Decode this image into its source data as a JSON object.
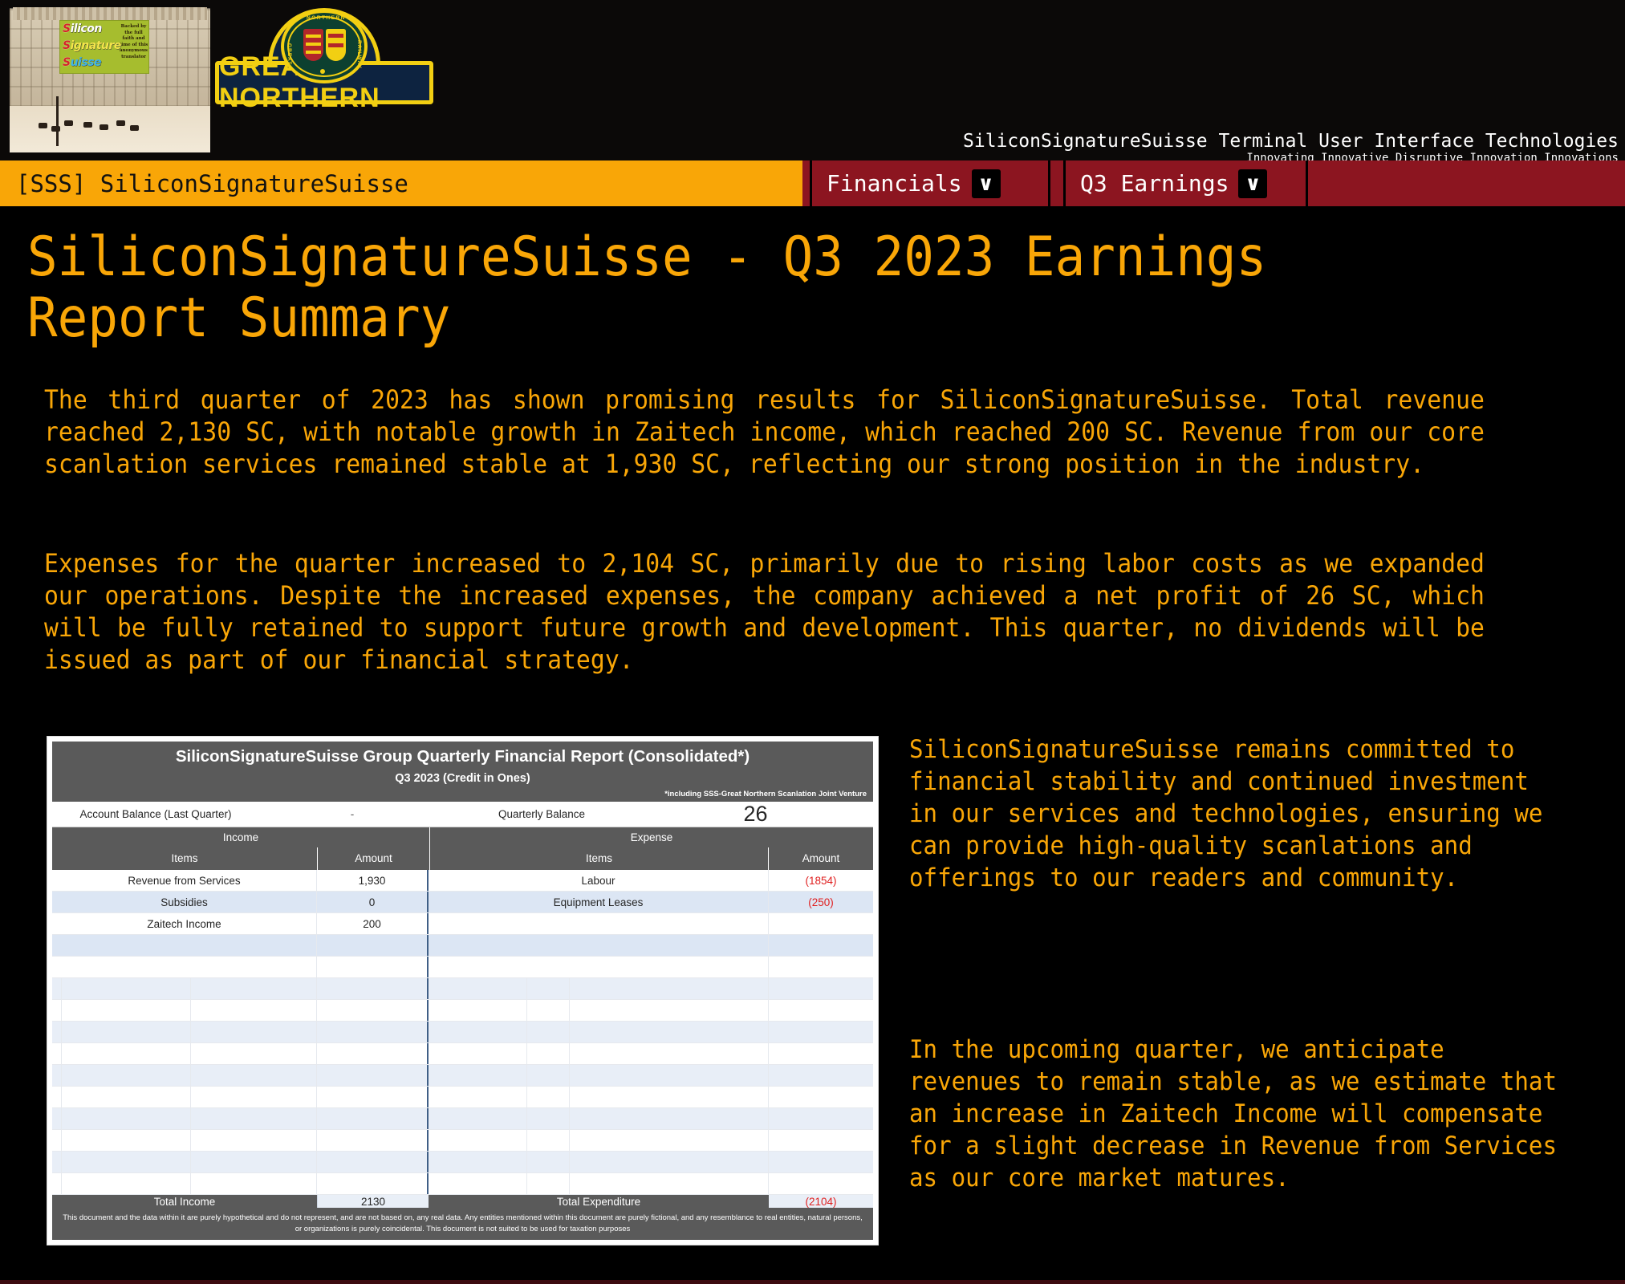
{
  "banner": {
    "billboard": {
      "s": "S",
      "word1": "ilicon",
      "word2": "ignature",
      "word3": "uisse",
      "side_text": "Backed by the full faith and time of this anonymous translator"
    },
    "great_northern": {
      "wordmark": "GREAT   NORTHERN",
      "ring_top": "NORTHERN",
      "ring_left": "GREAT",
      "ring_right": "RAILWAY"
    },
    "brand_line1": "SiliconSignatureSuisse Terminal User Interface Technologies",
    "brand_line2": "Innovating Innovative Disruptive Innovation Innovations"
  },
  "nav": {
    "brand": "[SSS] SiliconSignatureSuisse",
    "tabs": [
      {
        "label": "Financials",
        "caret": "∨"
      },
      {
        "label": "Q3 Earnings",
        "caret": "∨"
      }
    ]
  },
  "main": {
    "title": "SiliconSignatureSuisse - Q3 2023 Earnings Report Summary",
    "paragraph1": "The third quarter of 2023 has shown promising results for SiliconSignatureSuisse. Total revenue reached 2,130 SC, with notable growth in Zaitech income, which reached 200 SC. Revenue from our core scanlation services remained stable at 1,930 SC, reflecting our strong position in the industry.",
    "paragraph2": "Expenses for the quarter increased to 2,104 SC, primarily due to rising labor costs as we expanded our operations. Despite the increased expenses, the company achieved a net profit of 26 SC, which will be fully retained to support future growth and development. This quarter, no dividends will be issued as part of our financial strategy."
  },
  "sidebar": {
    "paragraph1": "SiliconSignatureSuisse remains committed to financial stability and continued investment in our services and technologies, ensuring we can provide high-quality scanlations and offerings to our readers and community.",
    "paragraph2": "In the upcoming quarter, we anticipate revenues to remain stable, as we estimate that an increase in Zaitech Income will compensate for a slight decrease in Revenue from Services as our core market matures."
  },
  "report": {
    "title": "SiliconSignatureSuisse Group Quarterly Financial Report (Consolidated*)",
    "subtitle": "Q3 2023 (Credit in Ones)",
    "note": "*including SSS-Great Northern Scanlation Joint Venture",
    "balance_label": "Account Balance (Last Quarter)",
    "balance_value": "-",
    "quarterly_label": "Quarterly Balance",
    "quarterly_value": "26",
    "group_income": "Income",
    "group_expense": "Expense",
    "col_items_income": "Items",
    "col_amount_income": "Amount",
    "col_items_expense": "Items",
    "col_amount_expense": "Amount",
    "rows": [
      {
        "income_item": "Revenue from Services",
        "income_amount": "1,930",
        "expense_item": "Labour",
        "expense_amount": "(1854)"
      },
      {
        "income_item": "Subsidies",
        "income_amount": "0",
        "expense_item": "Equipment Leases",
        "expense_amount": "(250)"
      },
      {
        "income_item": "Zaitech Income",
        "income_amount": "200",
        "expense_item": "",
        "expense_amount": ""
      }
    ],
    "total_income_label": "Total Income",
    "total_income_value": "2130",
    "total_expense_label": "Total Expenditure",
    "total_expense_value": "(2104)",
    "disclaimer": "This document and the data within it are purely hypothetical and do not represent, and are not based on, any real data. Any entities mentioned within this document are purely fictional, and any resemblance to real entities, natural persons, or organizations is purely coincidental. This document is not suited to be used for taxation purposes"
  },
  "colors": {
    "accent_orange": "#f9a607",
    "nav_red": "#8c1520",
    "table_header_gray": "#5a5a5a",
    "negative_red": "#e02020",
    "gn_yellow": "#f2cf12",
    "gn_navy": "#0d2340"
  }
}
